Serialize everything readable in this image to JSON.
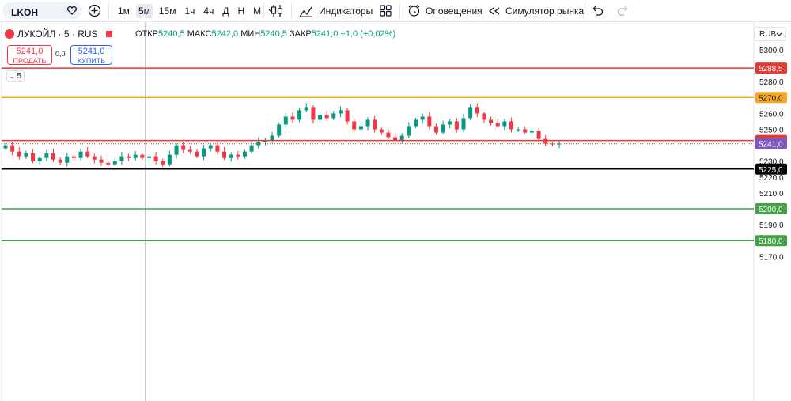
{
  "toolbar": {
    "symbol": "LKOH",
    "intervals": [
      "1м",
      "5м",
      "15м",
      "1ч",
      "4ч",
      "Д",
      "Н",
      "М"
    ],
    "active_interval": "5м",
    "indicators_label": "Индикаторы",
    "alerts_label": "Оповещения",
    "simulator_label": "Симулятор рынка"
  },
  "legend": {
    "title": "ЛУКОЙЛ · 5 · RUS",
    "open_label": "ОТКР",
    "open": "5240,5",
    "high_label": "МАКС",
    "high": "5242,0",
    "low_label": "МИН",
    "low": "5240,5",
    "close_label": "ЗАКР",
    "close": "5241,0",
    "change": "+1,0 (+0,02%)",
    "sell_price": "5241,0",
    "sell_label": "ПРОДАТЬ",
    "buy_price": "5241,0",
    "buy_label": "КУПИТЬ",
    "spread": "0,0",
    "collapsed_count": "5"
  },
  "currency": "RUB",
  "colors": {
    "up": "#089981",
    "down": "#f23645",
    "accent": "#2962ff"
  },
  "axis_ticks": [
    "5300,0",
    "5290,0",
    "5280,0",
    "5270,0",
    "5260,0",
    "5250,0",
    "5240,0",
    "5230,0",
    "5220,0",
    "5210,0",
    "5200,0",
    "5190,0",
    "5180,0",
    "5170,0"
  ],
  "levels": [
    {
      "price": 5288.5,
      "label": "5288,5",
      "color": "#e53935"
    },
    {
      "price": 5270.0,
      "label": "5270,0",
      "color": "#f5a623"
    },
    {
      "price": 5243.0,
      "label": "5243,0",
      "color": "#e53935"
    },
    {
      "price": 5225.0,
      "label": "5225,0",
      "color": "#000000"
    },
    {
      "price": 5200.0,
      "label": "5200,0",
      "color": "#43a047"
    },
    {
      "price": 5180.0,
      "label": "5180,0",
      "color": "#43a047"
    }
  ],
  "last_price": {
    "price": 5241.0,
    "label": "5241,0",
    "color": "#7e57c2"
  },
  "chart_data": {
    "type": "candlestick",
    "series_close": [
      5240.0,
      5236.0,
      5233.0,
      5235.0,
      5230.0,
      5232.0,
      5235.0,
      5231.0,
      5229.0,
      5233.0,
      5232.0,
      5236.0,
      5233.0,
      5231.0,
      5229.0,
      5228.0,
      5230.0,
      5233.0,
      5232.0,
      5234.0,
      5232.0,
      5233.0,
      5230.0,
      5228.0,
      5234.0,
      5240.0,
      5237.0,
      5236.0,
      5233.0,
      5238.0,
      5240.0,
      5236.0,
      5232.0,
      5234.0,
      5233.0,
      5236.0,
      5240.0,
      5242.0,
      5243.0,
      5246.0,
      5253.0,
      5258.0,
      5256.0,
      5262.0,
      5264.0,
      5256.0,
      5259.0,
      5257.0,
      5260.0,
      5262.0,
      5255.0,
      5250.0,
      5252.0,
      5256.0,
      5250.0,
      5248.0,
      5245.0,
      5243.0,
      5246.0,
      5252.0,
      5256.0,
      5258.0,
      5252.0,
      5248.0,
      5253.0,
      5255.0,
      5250.0,
      5257.0,
      5264.0,
      5260.0,
      5256.0,
      5254.0,
      5252.0,
      5255.0,
      5250.0,
      5250.0,
      5248.0,
      5249.0,
      5244.0,
      5241.0,
      5240.5,
      5241.0
    ]
  }
}
